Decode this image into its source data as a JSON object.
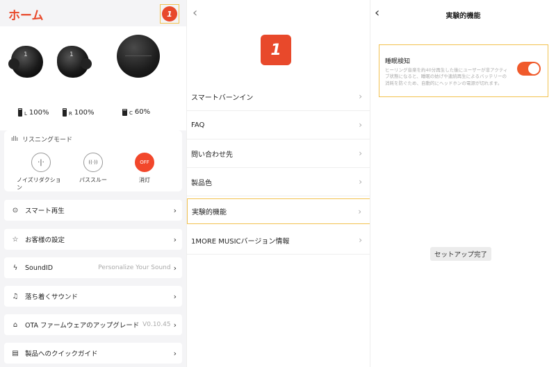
{
  "home": {
    "title": "ホーム",
    "logo_text": "1",
    "battery": [
      {
        "label": "100%",
        "sub": "L"
      },
      {
        "label": "100%",
        "sub": "R"
      },
      {
        "label": "60%",
        "sub": "C"
      }
    ],
    "listening": {
      "header": "リスニングモード",
      "modes": [
        {
          "label": "ノイズリダクション",
          "icon": "noise-reduction-icon",
          "glyph": "·|·"
        },
        {
          "label": "パススルー",
          "icon": "passthrough-icon",
          "glyph": "((·))"
        },
        {
          "label": "消灯",
          "icon": "off-icon",
          "glyph": "OFF"
        }
      ]
    },
    "menu": [
      {
        "label": "スマート再生",
        "icon": "smart-play-icon",
        "glyph": "⊙",
        "extra": ""
      },
      {
        "label": "お客様の設定",
        "icon": "customer-settings-icon",
        "glyph": "☆",
        "extra": ""
      },
      {
        "label": "SoundID",
        "icon": "soundid-icon",
        "glyph": "ϟ",
        "extra": "Personalize Your Sound"
      },
      {
        "label": "落ち着くサウンド",
        "icon": "calm-sound-icon",
        "glyph": "♫",
        "extra": ""
      },
      {
        "label": "OTA ファームウェアのアップグレード",
        "icon": "ota-upgrade-icon",
        "glyph": "⌂",
        "extra": "V0.10.45"
      },
      {
        "label": "製品へのクイックガイド",
        "icon": "quick-guide-icon",
        "glyph": "▤",
        "extra": ""
      }
    ]
  },
  "settings": {
    "logo_text": "1",
    "items": [
      {
        "label": "スマートバーンイン"
      },
      {
        "label": "FAQ"
      },
      {
        "label": "問い合わせ先"
      },
      {
        "label": "製品色"
      },
      {
        "label": "実験的機能"
      },
      {
        "label": "1MORE MUSICバージョン情報"
      }
    ]
  },
  "experimental": {
    "title": "実験的機能",
    "feature": {
      "name": "睡眠検知",
      "description": "ヒーリング音楽を約40分再生した後にユーザーが非アクティブ状態になると、睡眠の妨げや連続再生によるバッテリーの消耗を防ぐため、自動的にヘッドホンの電源が切れます。",
      "enabled": true
    },
    "toast": "セットアップ完了"
  },
  "colors": {
    "accent": "#e8492b",
    "toggle_on": "#f05a2b",
    "highlight": "#f2c14e"
  }
}
